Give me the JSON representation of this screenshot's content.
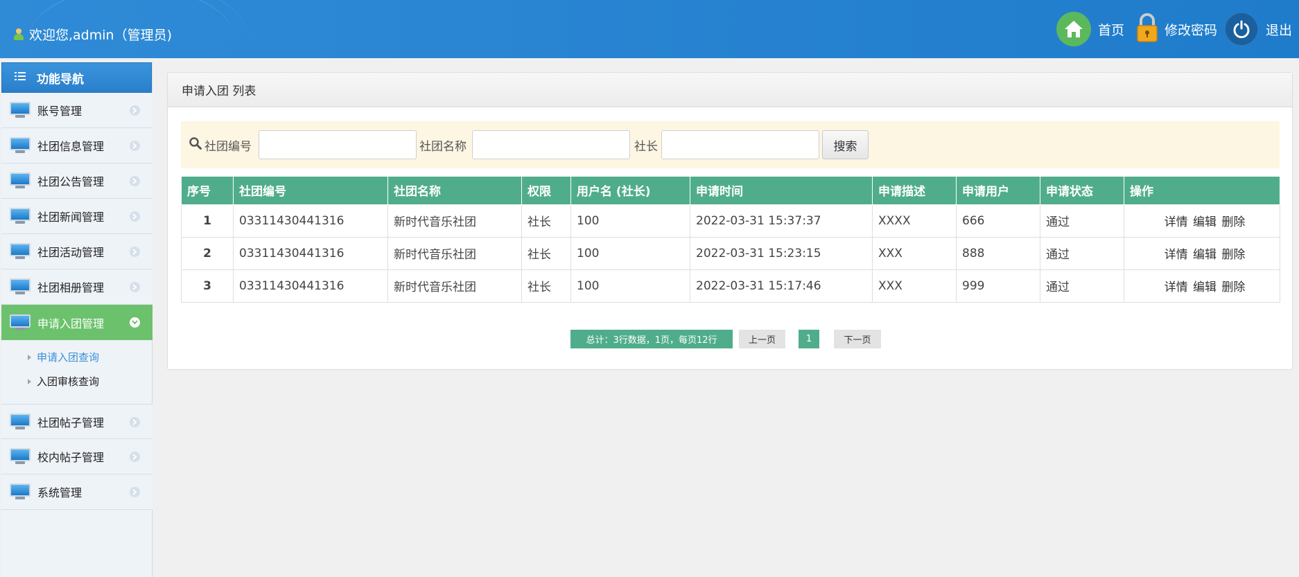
{
  "header": {
    "welcome": "欢迎您,admin（管理员)",
    "home_label": "首页",
    "password_label": "修改密码",
    "logout_label": "退出"
  },
  "sidebar": {
    "title": "功能导航",
    "items": [
      {
        "label": "账号管理"
      },
      {
        "label": "社团信息管理"
      },
      {
        "label": "社团公告管理"
      },
      {
        "label": "社团新闻管理"
      },
      {
        "label": "社团活动管理"
      },
      {
        "label": "社团相册管理"
      },
      {
        "label": "申请入团管理"
      },
      {
        "label": "社团帖子管理"
      },
      {
        "label": "校内帖子管理"
      },
      {
        "label": "系统管理"
      }
    ],
    "subitems": [
      {
        "label": "申请入团查询"
      },
      {
        "label": "入团审核查询"
      }
    ]
  },
  "panel": {
    "title": "申请入团 列表"
  },
  "search": {
    "label_code": "社团编号",
    "label_name": "社团名称",
    "label_leader": "社长",
    "code_value": "",
    "name_value": "",
    "leader_value": "",
    "button": "搜索"
  },
  "table": {
    "headers": [
      "序号",
      "社团编号",
      "社团名称",
      "权限",
      "用户名 (社长)",
      "申请时间",
      "申请描述",
      "申请用户",
      "申请状态",
      "操作"
    ],
    "rows": [
      {
        "idx": "1",
        "code": "03311430441316",
        "name": "新时代音乐社团",
        "role": "社长",
        "user": "100",
        "time": "2022-03-31 15:37:37",
        "desc": "XXXX",
        "applicant": "666",
        "status": "通过"
      },
      {
        "idx": "2",
        "code": "03311430441316",
        "name": "新时代音乐社团",
        "role": "社长",
        "user": "100",
        "time": "2022-03-31 15:23:15",
        "desc": "XXX",
        "applicant": "888",
        "status": "通过"
      },
      {
        "idx": "3",
        "code": "03311430441316",
        "name": "新时代音乐社团",
        "role": "社长",
        "user": "100",
        "time": "2022-03-31 15:17:46",
        "desc": "XXX",
        "applicant": "999",
        "status": "通过"
      }
    ],
    "ops": {
      "detail": "详情",
      "edit": "编辑",
      "delete": "删除"
    }
  },
  "pager": {
    "total": "总计：3行数据，1页，每页12行",
    "prev": "上一页",
    "current": "1",
    "next": "下一页"
  },
  "colors": {
    "header_blue": "#2a86d3",
    "accent_green": "#50ad8c",
    "active_green": "#6cc26c",
    "search_bg": "#fdf6e3"
  }
}
